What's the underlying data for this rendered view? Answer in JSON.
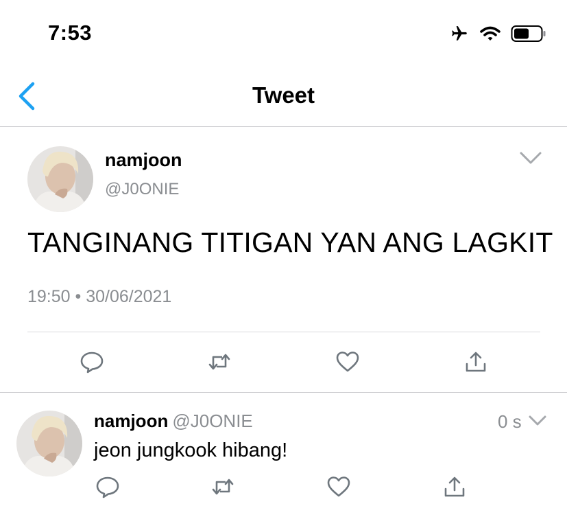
{
  "status_bar": {
    "time": "7:53",
    "icons": [
      "airplane-icon",
      "wifi-icon",
      "battery-icon"
    ]
  },
  "nav": {
    "title": "Tweet",
    "back_icon": "chevron-left-icon"
  },
  "main_tweet": {
    "name": "namjoon",
    "handle": "@J0ONIE",
    "text": "TANGINANG TITIGAN YAN ANG LAGKIT",
    "timestamp": "19:50 • 30/06/2021",
    "actions": [
      "reply-icon",
      "retweet-icon",
      "like-icon",
      "share-icon"
    ]
  },
  "reply_tweet": {
    "name": "namjoon",
    "handle": "@J0ONIE",
    "age": "0 s",
    "text": "jeon jungkook hibang!",
    "actions": [
      "reply-icon",
      "retweet-icon",
      "like-icon",
      "share-icon"
    ]
  },
  "colors": {
    "accent": "#1DA1F2",
    "secondary_text": "#8a8d91",
    "icon": "#6e767d"
  }
}
